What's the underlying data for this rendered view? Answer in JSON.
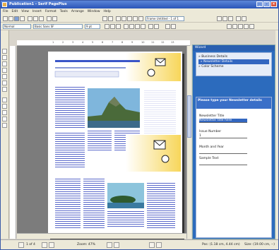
{
  "window": {
    "title": "Publication1 - Serif PagePlus"
  },
  "menu": [
    "File",
    "Edit",
    "View",
    "Insert",
    "Format",
    "Tools",
    "Arrange",
    "Window",
    "Help"
  ],
  "toolbar": {
    "style_value": "Normal",
    "font_value": "Basic Sans SF",
    "size_value": "9 pt",
    "frame_value": "Frame Untitled - 1 of 1"
  },
  "ruler_ticks": [
    "1",
    "2",
    "3",
    "4",
    "5",
    "6",
    "7",
    "8",
    "9",
    "10",
    "11",
    "12",
    "13"
  ],
  "taskpane": {
    "header": "Wizard",
    "links": [
      "Business Details",
      "Newsletter Details",
      "Color Scheme"
    ],
    "selected_link": 1,
    "form_title": "Please type your Newsletter details",
    "fields": [
      {
        "label": "Newsletter Title",
        "value": "Newsletter title here",
        "highlight": true
      },
      {
        "label": "Issue Number",
        "value": "1",
        "highlight": false
      },
      {
        "label": "Month and Year",
        "value": "",
        "highlight": false
      },
      {
        "label": "Sample Text",
        "value": "",
        "highlight": false
      }
    ]
  },
  "status": {
    "page": "1 of 4",
    "zoom": "Zoom: 47%",
    "position": "Pos: (1.18 cm, 4.44 cm)",
    "size": "Size: (19.00 cm, --)"
  }
}
